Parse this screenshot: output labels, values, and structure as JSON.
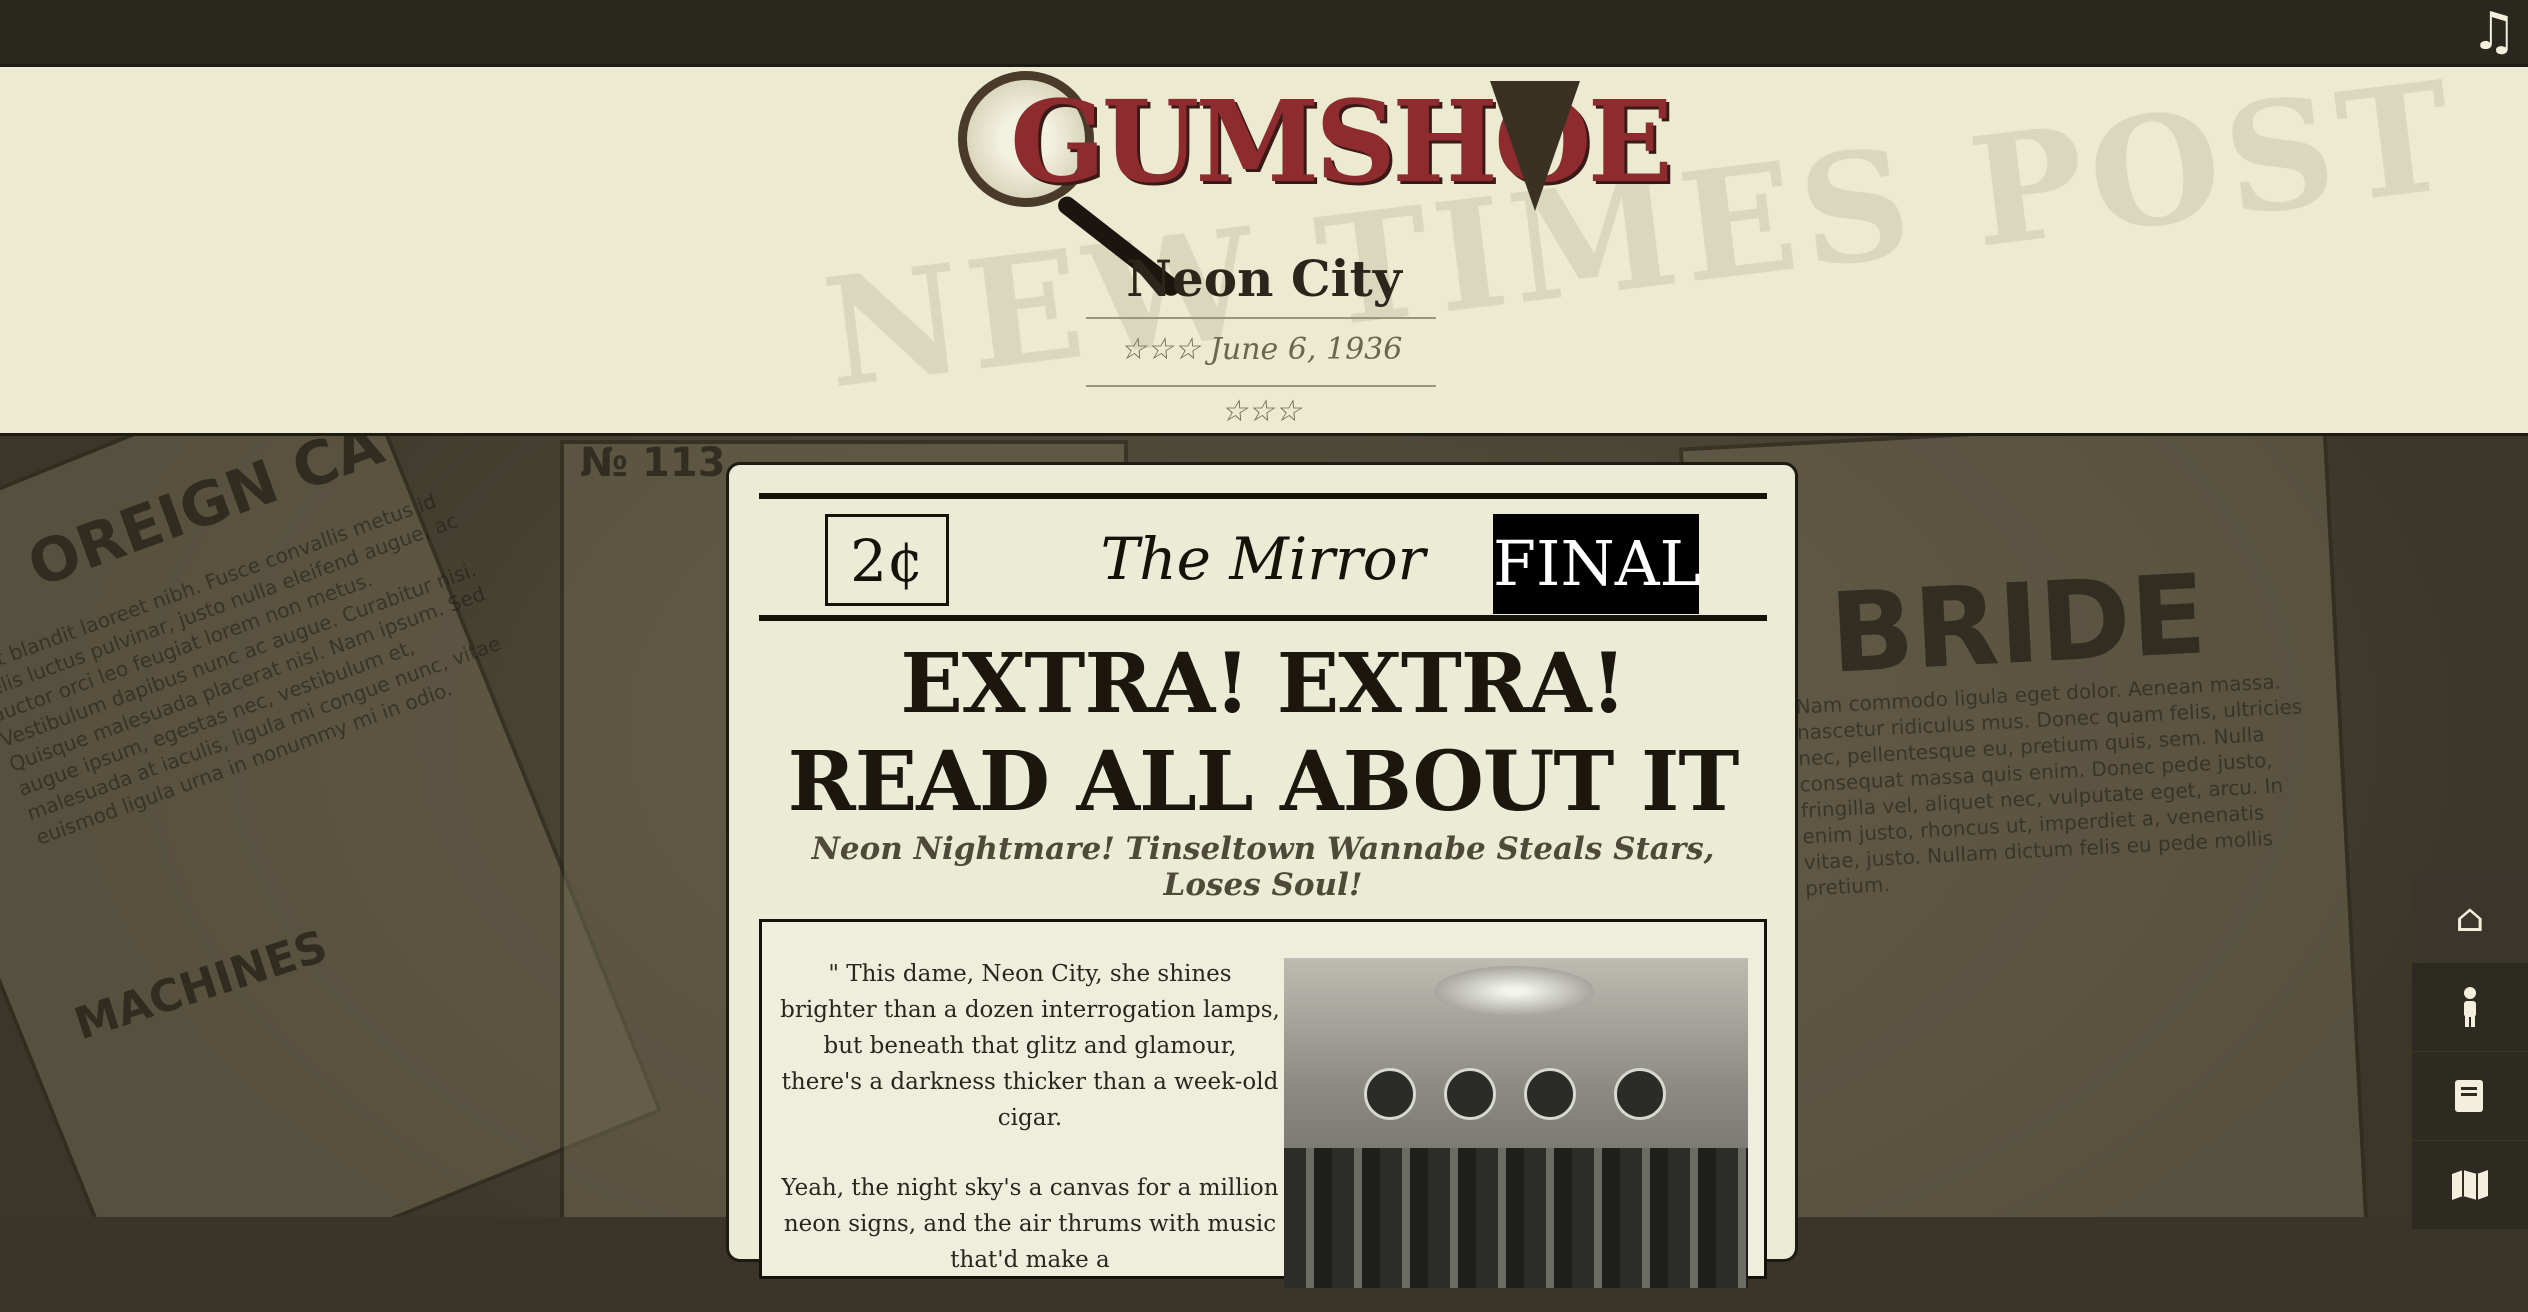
{
  "header": {
    "logo_text": "GUMSHOE",
    "city": "Neon City",
    "date": "☆☆☆ June 6, 1936 ☆☆☆"
  },
  "masthead": {
    "price": "2¢",
    "paper_name": "The Mirror",
    "edition": "FINAL"
  },
  "story": {
    "headline": "EXTRA! EXTRA! READ ALL ABOUT IT",
    "subheadline": "Neon Nightmare! Tinseltown Wannabe Steals Stars, Loses Soul!",
    "paragraphs": [
      "\" This dame, Neon City, she shines brighter than a dozen interrogation lamps, but beneath that glitz and glamour, there's a darkness thicker than a week-old cigar.",
      "Yeah, the night sky's a canvas for a million neon signs, and the air thrums with music that'd make a"
    ]
  },
  "nav": {
    "items": [
      {
        "icon": "home-icon"
      },
      {
        "icon": "person-icon"
      },
      {
        "icon": "book-icon"
      },
      {
        "icon": "map-icon"
      }
    ]
  },
  "toolbar": {
    "music_icon": "music-note-icon"
  }
}
